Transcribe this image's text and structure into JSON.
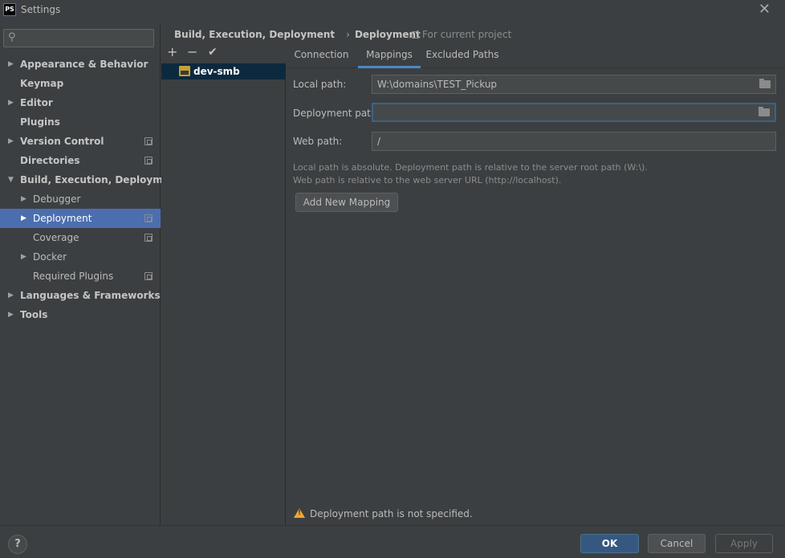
{
  "window": {
    "title": "Settings",
    "app_badge": "PS",
    "close_glyph": "✕"
  },
  "search": {
    "placeholder": "",
    "icon": "search-icon"
  },
  "tree": [
    {
      "label": "Appearance & Behavior",
      "bold": true,
      "arrow": "▶",
      "level": 0
    },
    {
      "label": "Keymap",
      "bold": true,
      "arrow": "",
      "level": 0
    },
    {
      "label": "Editor",
      "bold": true,
      "arrow": "▶",
      "level": 0
    },
    {
      "label": "Plugins",
      "bold": true,
      "arrow": "",
      "level": 0
    },
    {
      "label": "Version Control",
      "bold": true,
      "arrow": "▶",
      "level": 0,
      "project": true
    },
    {
      "label": "Directories",
      "bold": true,
      "arrow": "",
      "level": 0,
      "project": true
    },
    {
      "label": "Build, Execution, Deployment",
      "bold": true,
      "arrow": "▼",
      "level": 0
    },
    {
      "label": "Debugger",
      "bold": false,
      "arrow": "▶",
      "level": 1
    },
    {
      "label": "Deployment",
      "bold": false,
      "arrow": "▶",
      "level": 1,
      "project": true,
      "selected": true
    },
    {
      "label": "Coverage",
      "bold": false,
      "arrow": "",
      "level": 1,
      "project": true
    },
    {
      "label": "Docker",
      "bold": false,
      "arrow": "▶",
      "level": 1
    },
    {
      "label": "Required Plugins",
      "bold": false,
      "arrow": "",
      "level": 1,
      "project": true
    },
    {
      "label": "Languages & Frameworks",
      "bold": true,
      "arrow": "▶",
      "level": 0
    },
    {
      "label": "Tools",
      "bold": true,
      "arrow": "▶",
      "level": 0
    }
  ],
  "breadcrumb": {
    "parent": "Build, Execution, Deployment",
    "separator": "›",
    "current": "Deployment"
  },
  "scope": {
    "label": "For current project"
  },
  "toolbar": {
    "add": "+",
    "remove": "−",
    "check": "✔"
  },
  "servers": [
    {
      "label": "dev-smb"
    }
  ],
  "tabs": [
    {
      "label": "Connection",
      "active": false
    },
    {
      "label": "Mappings",
      "active": true
    },
    {
      "label": "Excluded Paths",
      "active": false
    }
  ],
  "mapping": {
    "local_path_label": "Local path:",
    "local_path_value": "W:\\domains\\TEST_Pickup",
    "deployment_path_label": "Deployment path:",
    "deployment_path_value": "",
    "web_path_label": "Web path:",
    "web_path_value": "/",
    "hint_line1": "Local path is absolute. Deployment path is relative to the server root path (W:\\).",
    "hint_line2": "Web path is relative to the web server URL (http://localhost).",
    "add_mapping_label": "Add New Mapping"
  },
  "warning": {
    "text": "Deployment path is not specified."
  },
  "footer": {
    "help": "?",
    "ok": "OK",
    "cancel": "Cancel",
    "apply": "Apply"
  },
  "colors": {
    "background": "#3c3f41",
    "selection": "#4b6eaf",
    "accent": "#4a88c7",
    "warning": "#f0a732",
    "primary_button": "#365880"
  }
}
